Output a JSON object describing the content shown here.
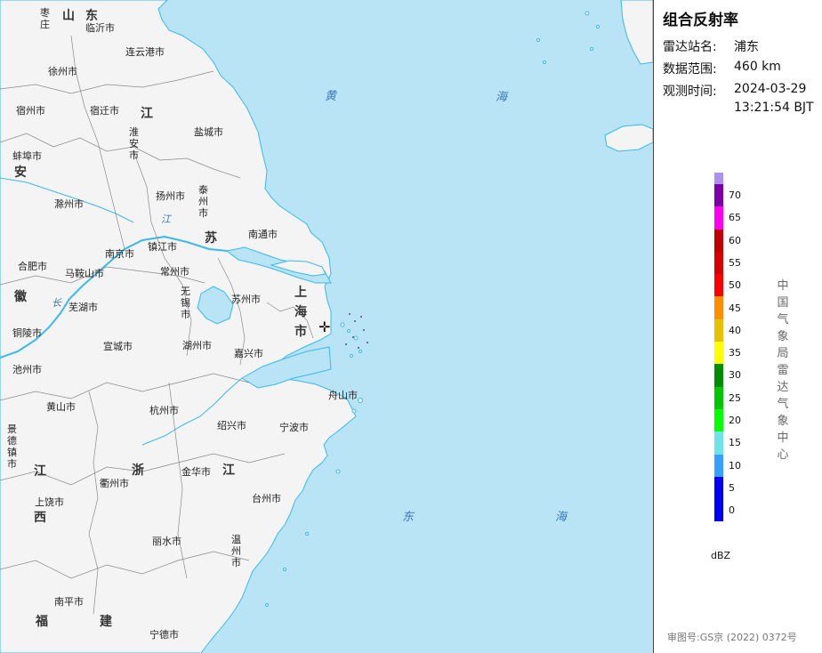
{
  "panel": {
    "title": "组合反射率",
    "station_label": "雷达站名:",
    "station_value": "浦东",
    "range_label": "数据范围:",
    "range_value": "460 km",
    "time_label": "观测时间:",
    "time_date": "2024-03-29",
    "time_clock": "13:21:54 BJT",
    "unit": "dBZ",
    "organization": "中国气象局雷达气象中心",
    "approval": "审图号:GS京 (2022) 0372号"
  },
  "legend": [
    {
      "color": "#ad90f0",
      "label": ""
    },
    {
      "color": "#7e00a6",
      "label": "70"
    },
    {
      "color": "#ff00f0",
      "label": "65"
    },
    {
      "color": "#c00000",
      "label": "60"
    },
    {
      "color": "#d60000",
      "label": "55"
    },
    {
      "color": "#ff0000",
      "label": "50"
    },
    {
      "color": "#ff8f00",
      "label": "45"
    },
    {
      "color": "#e7c000",
      "label": "40"
    },
    {
      "color": "#ffff00",
      "label": "35"
    },
    {
      "color": "#008e00",
      "label": "30"
    },
    {
      "color": "#00c800",
      "label": "25"
    },
    {
      "color": "#02ff02",
      "label": "20"
    },
    {
      "color": "#6ee3e9",
      "label": "15"
    },
    {
      "color": "#37a0ff",
      "label": "10"
    },
    {
      "color": "#0000f6",
      "label": "5"
    },
    {
      "color": "#0000f6",
      "label": "0"
    }
  ],
  "map": {
    "colors": {
      "sea": "#b8e4f5",
      "land": "#f4f4f4",
      "river": "#39b9f0",
      "border": "#8a8a8a"
    },
    "sea_labels": [
      "黄",
      "海",
      "东",
      "海"
    ],
    "provinces": {
      "shandong": "山东",
      "jiangsu_1": "江",
      "jiangsu_2": "苏",
      "anhui_1": "安",
      "anhui_2": "徽",
      "shanghai": "上海市",
      "zhejiang_1": "浙",
      "zhejiang_2": "江",
      "jiangxi_1": "江",
      "jiangxi_2": "西",
      "fujian_1": "福",
      "fujian_2": "建"
    },
    "cities": {
      "zaozhuang": "枣庄",
      "linyi": "临沂市",
      "lianyungang": "连云港市",
      "xuzhou": "徐州市",
      "suzhou_ah": "宿州市",
      "suqian": "宿迁市",
      "huaian": "淮安市",
      "yancheng": "盐城市",
      "bengbu": "蚌埠市",
      "chuzhou": "滁州市",
      "yangzhou": "扬州市",
      "taizhou_js": "泰州市",
      "nantong": "南通市",
      "nanjing": "南京市",
      "zhenjiang": "镇江市",
      "changzhou": "常州市",
      "hefei": "合肥市",
      "maanshan": "马鞍山市",
      "wuxi": "无锡市",
      "suzhou_js": "苏州市",
      "wuhu": "芜湖市",
      "tongling": "铜陵市",
      "xuancheng": "宣城市",
      "huzhou": "湖州市",
      "jiaxing": "嘉兴市",
      "chizhou": "池州市",
      "huangshan": "黄山市",
      "hangzhou": "杭州市",
      "shaoxing": "绍兴市",
      "ningbo": "宁波市",
      "zhoushan": "舟山市",
      "jingdezhen": "景德镇市",
      "quzhou": "衢州市",
      "jinhua": "金华市",
      "taizhou_zj": "台州市",
      "shangrao": "上饶市",
      "lishui": "丽水市",
      "wenzhou": "温州市",
      "nanping": "南平市",
      "ningde": "宁德市",
      "river_jiang": "江",
      "river_chang": "长"
    }
  }
}
